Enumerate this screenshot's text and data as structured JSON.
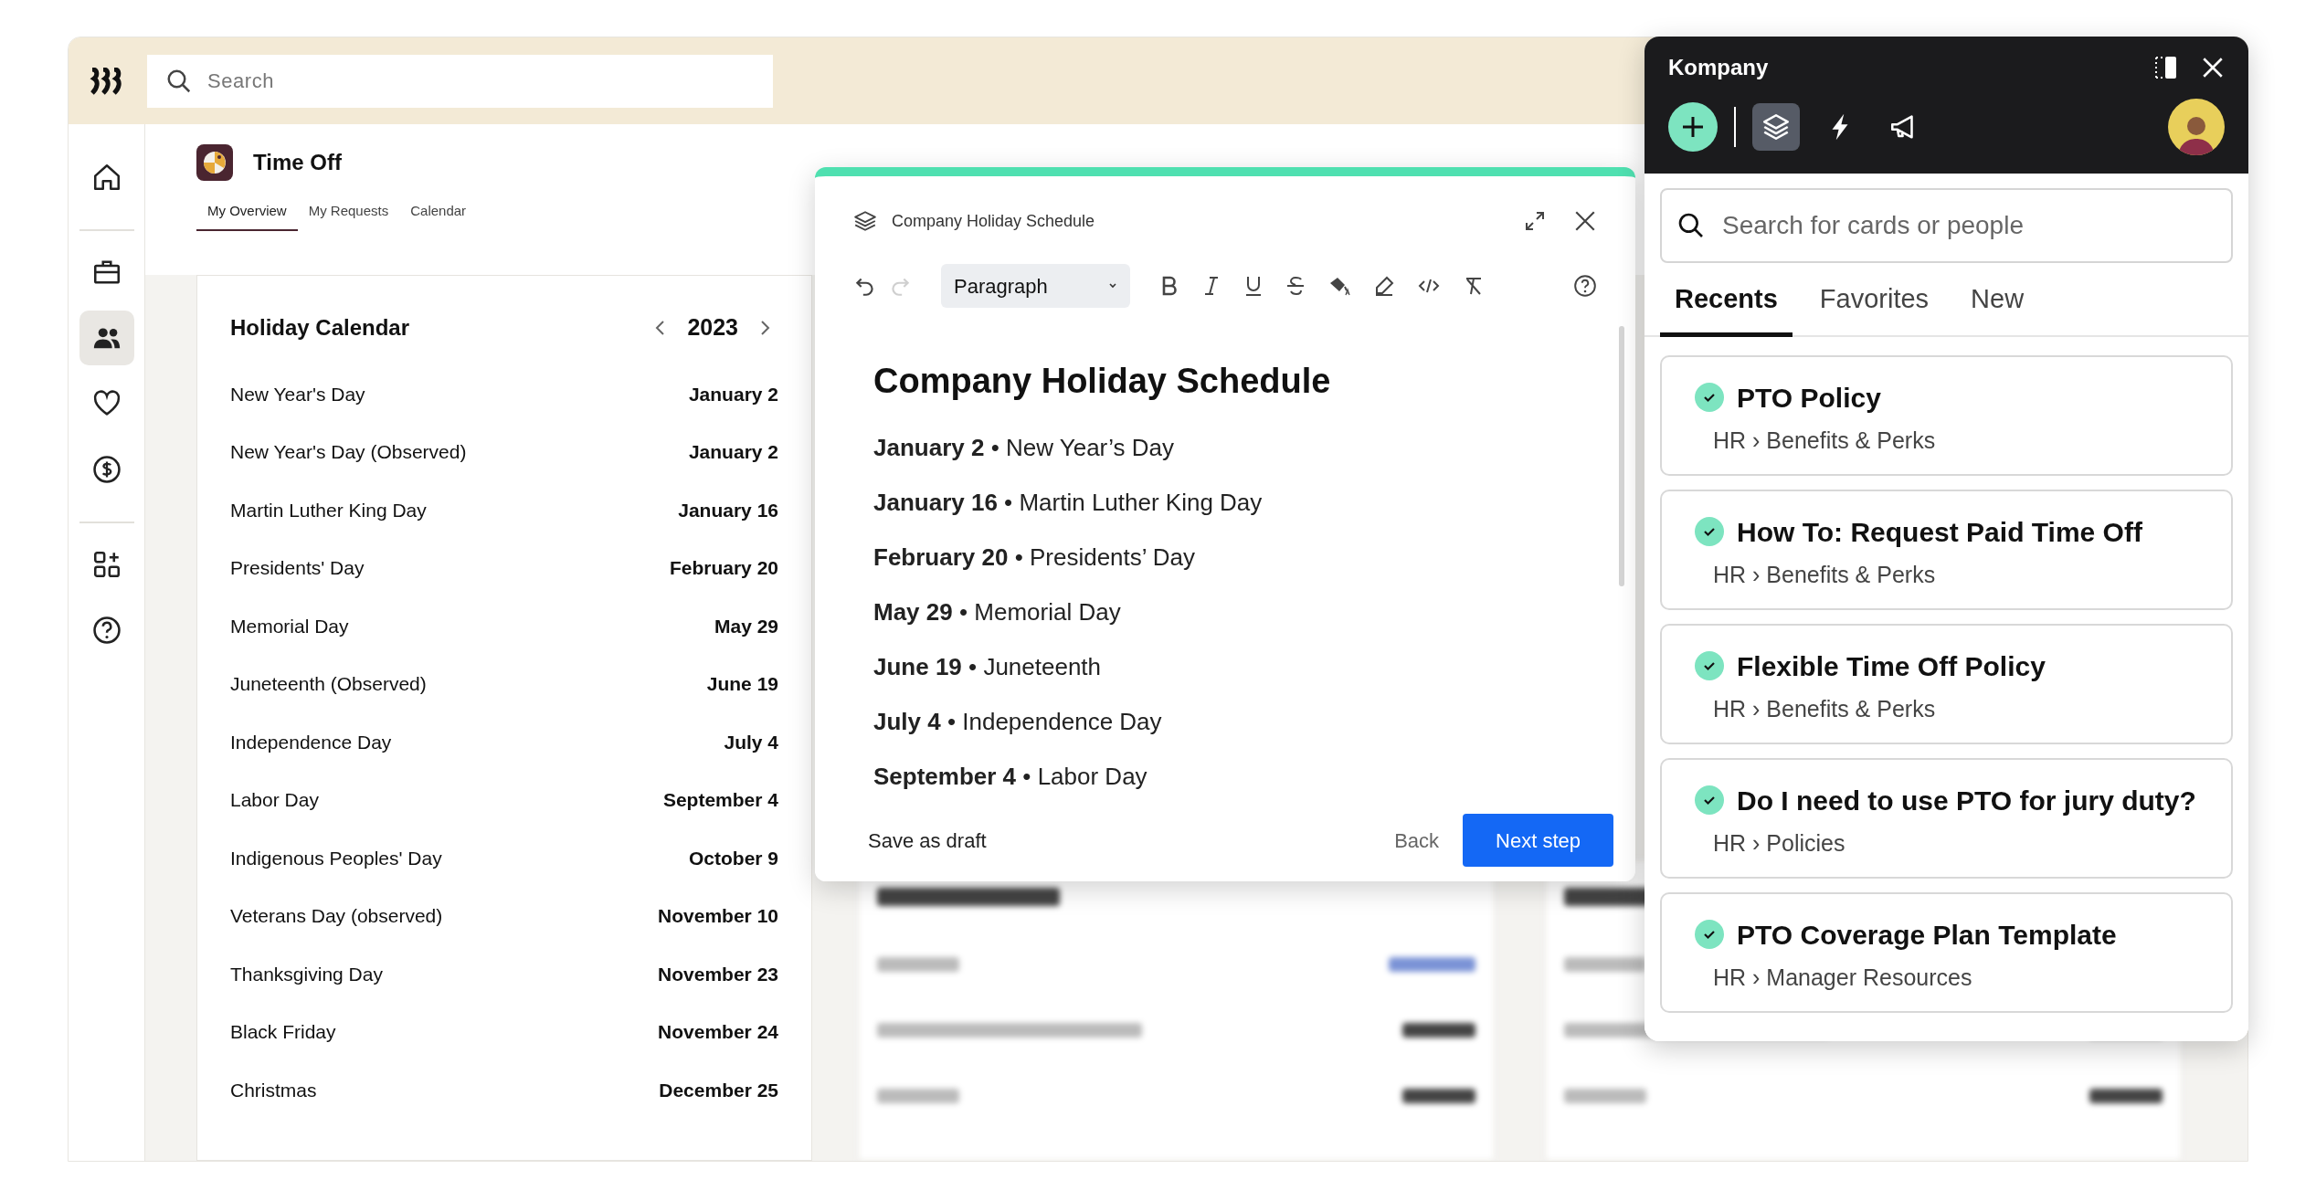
{
  "topbar": {
    "search": {
      "placeholder": "Search"
    }
  },
  "sidebar": [
    {
      "selected": false
    },
    {
      "selected": false
    },
    {
      "selected": true
    },
    {
      "selected": false
    },
    {
      "selected": false
    },
    {
      "selected": false
    },
    {
      "selected": false
    }
  ],
  "page": {
    "title": "Time Off",
    "tabs": [
      {
        "label": "My Overview",
        "selected": true
      },
      {
        "label": "My Requests",
        "selected": false
      },
      {
        "label": "Calendar",
        "selected": false
      }
    ]
  },
  "holiday_calendar": {
    "title": "Holiday Calendar",
    "year": "2023",
    "holidays": [
      {
        "name": "New Year's Day",
        "date": "January 2"
      },
      {
        "name": "New Year's Day (Observed)",
        "date": "January 2"
      },
      {
        "name": "Martin Luther King Day",
        "date": "January 16"
      },
      {
        "name": "Presidents' Day",
        "date": "February 20"
      },
      {
        "name": "Memorial Day",
        "date": "May 29"
      },
      {
        "name": "Juneteenth (Observed)",
        "date": "June 19"
      },
      {
        "name": "Independence Day",
        "date": "July 4"
      },
      {
        "name": "Labor Day",
        "date": "September 4"
      },
      {
        "name": "Indigenous Peoples' Day",
        "date": "October 9"
      },
      {
        "name": "Veterans Day (observed)",
        "date": "November 10"
      },
      {
        "name": "Thanksgiving Day",
        "date": "November 23"
      },
      {
        "name": "Black Friday",
        "date": "November 24"
      },
      {
        "name": "Christmas",
        "date": "December 25"
      }
    ]
  },
  "editor": {
    "title": "Company Holiday Schedule",
    "history": [
      {
        "kind": "undo",
        "disabled": false
      },
      {
        "kind": "redo",
        "disabled": true
      }
    ],
    "block_format": "Paragraph",
    "heading": "Company Holiday Schedule",
    "lines": [
      "**January 2** • New Year’s Day",
      "**January 16** • Martin Luther King Day",
      "**February 20** • Presidents’ Day",
      "**May 29** • Memorial Day",
      "**June 19** • Juneteenth",
      "**July 4** • Independence Day",
      "**September 4** • Labor Day"
    ],
    "save_draft": "Save as draft",
    "back": "Back",
    "next": "Next step"
  },
  "kompany": {
    "title": "Kompany",
    "tools": [
      {
        "kind": "layers",
        "selected": true
      },
      {
        "kind": "bolt",
        "selected": false
      },
      {
        "kind": "megaphone",
        "selected": false
      }
    ],
    "search": {
      "placeholder": "Search for cards or people"
    },
    "tabs": [
      {
        "label": "Recents",
        "selected": true
      },
      {
        "label": "Favorites",
        "selected": false
      },
      {
        "label": "New",
        "selected": false
      }
    ],
    "cards": [
      {
        "title": "PTO Policy",
        "breadcrumb": "HR › Benefits & Perks",
        "verified": true
      },
      {
        "title": "How To: Request Paid Time Off",
        "breadcrumb": "HR › Benefits & Perks",
        "verified": true
      },
      {
        "title": "Flexible Time Off Policy",
        "breadcrumb": "HR › Benefits & Perks",
        "verified": true
      },
      {
        "title": "Do I need to use PTO for jury duty?",
        "breadcrumb": "HR › Policies",
        "verified": true
      },
      {
        "title": "PTO Coverage Plan Template",
        "breadcrumb": "HR › Manager Resources",
        "verified": true
      }
    ]
  }
}
